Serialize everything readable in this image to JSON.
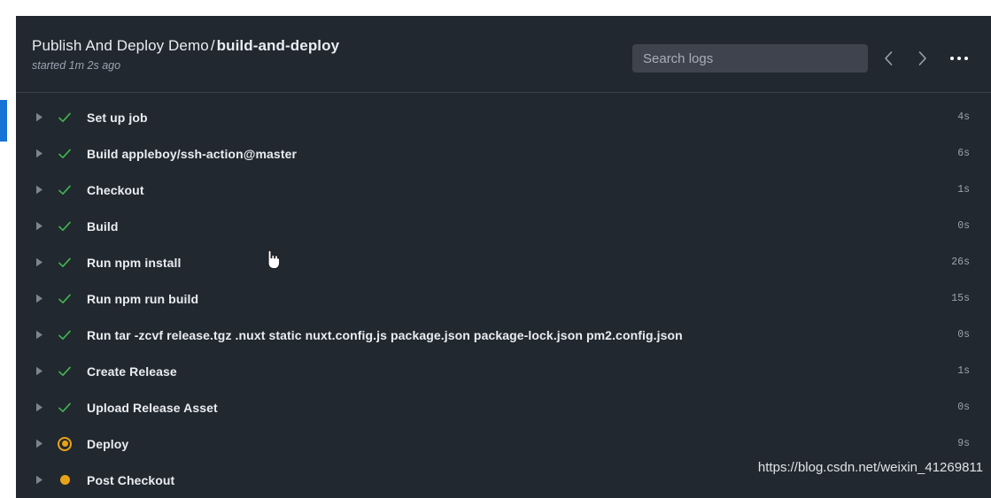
{
  "header": {
    "breadcrumb_parent": "Publish And Deploy Demo",
    "breadcrumb_separator": "/",
    "breadcrumb_current": "build-and-deploy",
    "started_text": "started 1m 2s ago",
    "search_placeholder": "Search logs",
    "search_value": "",
    "prev_icon": "chevron-left-icon",
    "next_icon": "chevron-right-icon",
    "more_icon": "kebab-menu-icon"
  },
  "steps": [
    {
      "name": "Set up job",
      "duration": "4s",
      "status": "success"
    },
    {
      "name": "Build appleboy/ssh-action@master",
      "duration": "6s",
      "status": "success"
    },
    {
      "name": "Checkout",
      "duration": "1s",
      "status": "success"
    },
    {
      "name": "Build",
      "duration": "0s",
      "status": "success"
    },
    {
      "name": "Run npm install",
      "duration": "26s",
      "status": "success"
    },
    {
      "name": "Run npm run build",
      "duration": "15s",
      "status": "success"
    },
    {
      "name": "Run tar -zcvf release.tgz .nuxt static nuxt.config.js package.json package-lock.json pm2.config.json",
      "duration": "0s",
      "status": "success"
    },
    {
      "name": "Create Release",
      "duration": "1s",
      "status": "success"
    },
    {
      "name": "Upload Release Asset",
      "duration": "0s",
      "status": "success"
    },
    {
      "name": "Deploy",
      "duration": "9s",
      "status": "running"
    },
    {
      "name": "Post Checkout",
      "duration": "",
      "status": "pending"
    }
  ],
  "watermark": "https://blog.csdn.net/weixin_41269811",
  "colors": {
    "panel_bg": "#22282f",
    "header_bg": "#212830",
    "accent_blue": "#1773d6",
    "success_green": "#3fb950",
    "pending_orange": "#e8a317",
    "text_primary": "#e9edf2",
    "text_muted": "#9aa4b0",
    "search_bg": "#3f434d"
  }
}
